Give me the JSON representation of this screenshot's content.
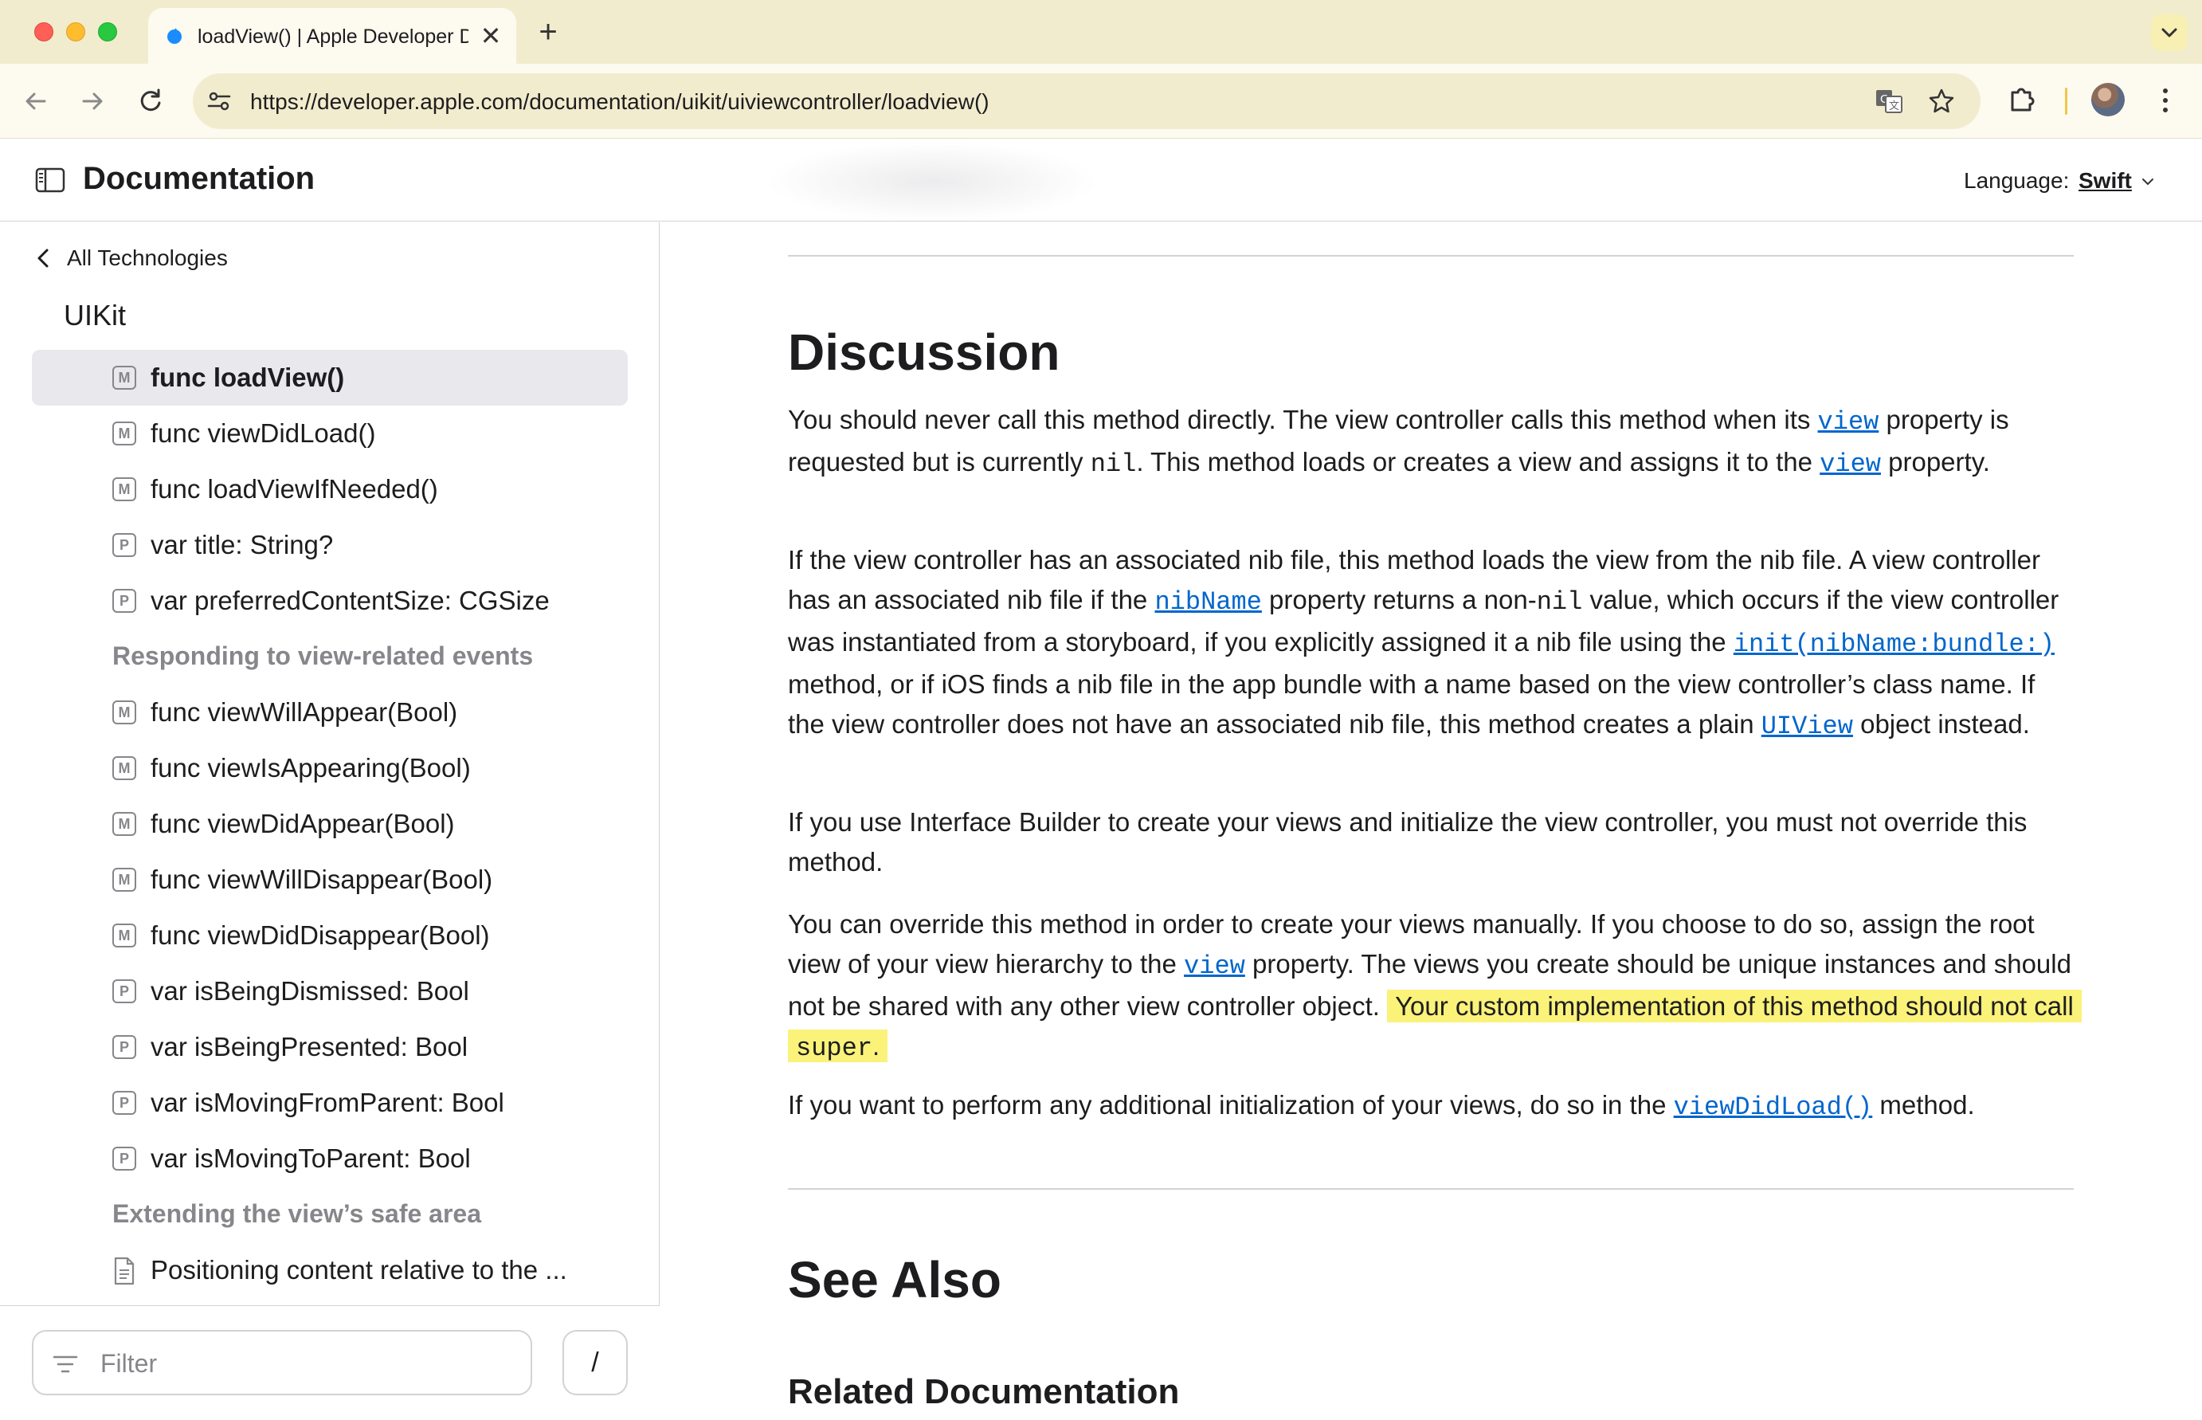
{
  "browser": {
    "tab_title": "loadView() | Apple Developer Documentation",
    "new_tab": "+",
    "close_tab": "✕",
    "url": "https://developer.apple.com/documentation/uikit/uiviewcontroller/loadview()"
  },
  "header": {
    "title": "Documentation",
    "language_label": "Language:",
    "language_value": "Swift"
  },
  "sidebar": {
    "back_label": "All Technologies",
    "framework": "UIKit",
    "items": [
      {
        "badge": "M",
        "label": "func loadView()",
        "selected": true
      },
      {
        "badge": "M",
        "label": "func viewDidLoad()"
      },
      {
        "badge": "M",
        "label": "func loadViewIfNeeded()"
      },
      {
        "badge": "P",
        "label": "var title: String?"
      },
      {
        "badge": "P",
        "label": "var preferredContentSize: CGSize"
      },
      {
        "heading": "Responding to view-related events"
      },
      {
        "badge": "M",
        "label": "func viewWillAppear(Bool)"
      },
      {
        "badge": "M",
        "label": "func viewIsAppearing(Bool)"
      },
      {
        "badge": "M",
        "label": "func viewDidAppear(Bool)"
      },
      {
        "badge": "M",
        "label": "func viewWillDisappear(Bool)"
      },
      {
        "badge": "M",
        "label": "func viewDidDisappear(Bool)"
      },
      {
        "badge": "P",
        "label": "var isBeingDismissed: Bool"
      },
      {
        "badge": "P",
        "label": "var isBeingPresented: Bool"
      },
      {
        "badge": "P",
        "label": "var isMovingFromParent: Bool"
      },
      {
        "badge": "P",
        "label": "var isMovingToParent: Bool"
      },
      {
        "heading": "Extending the view’s safe area"
      },
      {
        "badge": "doc",
        "label": "Positioning content relative to the ..."
      }
    ],
    "filter_placeholder": "Filter",
    "filter_shortcut": "/"
  },
  "content": {
    "discussion_heading": "Discussion",
    "p1": {
      "t1": "You should never call this method directly. The view controller calls this method when its ",
      "link1": "view",
      "t2": " property is requested but is currently ",
      "code1": "nil",
      "t3": ". This method loads or creates a view and assigns it to the ",
      "link2": "view",
      "t4": " property."
    },
    "p2": {
      "t1": "If the view controller has an associated nib file, this method loads the view from the nib file. A view controller has an associated nib file if the ",
      "link1": "nibName",
      "t2": " property returns a non-",
      "code1": "nil",
      "t3": " value, which occurs if the view controller was instantiated from a storyboard, if you explicitly assigned it a nib file using the ",
      "link2": "init(nibName:bundle:)",
      "t4": " method, or if iOS finds a nib file in the app bundle with a name based on the view controller’s class name. If the view controller does not have an associated nib file, this method creates a plain ",
      "link3": "UIView",
      "t5": " object instead."
    },
    "p3": "If you use Interface Builder to create your views and initialize the view controller, you must not override this method.",
    "p4": {
      "t1": "You can override this method in order to create your views manually. If you choose to do so, assign the root view of your view hierarchy to the ",
      "link1": "view",
      "t2": " property. The views you create should be unique instances and should not be shared with any other view controller object.",
      "highlight": "Your custom implementation of this method should not call ",
      "code1": "super",
      "t3": "."
    },
    "p5": {
      "t1": "If you want to perform any additional initialization of your views, do so in the ",
      "link1": "viewDidLoad()",
      "t2": " method."
    },
    "see_also_heading": "See Also",
    "related_heading": "Related Documentation"
  },
  "colors": {
    "link": "#0066cc",
    "highlight": "#fbf27a",
    "tab_strip": "#f2ecce",
    "selected_row": "#e8e8ed"
  }
}
